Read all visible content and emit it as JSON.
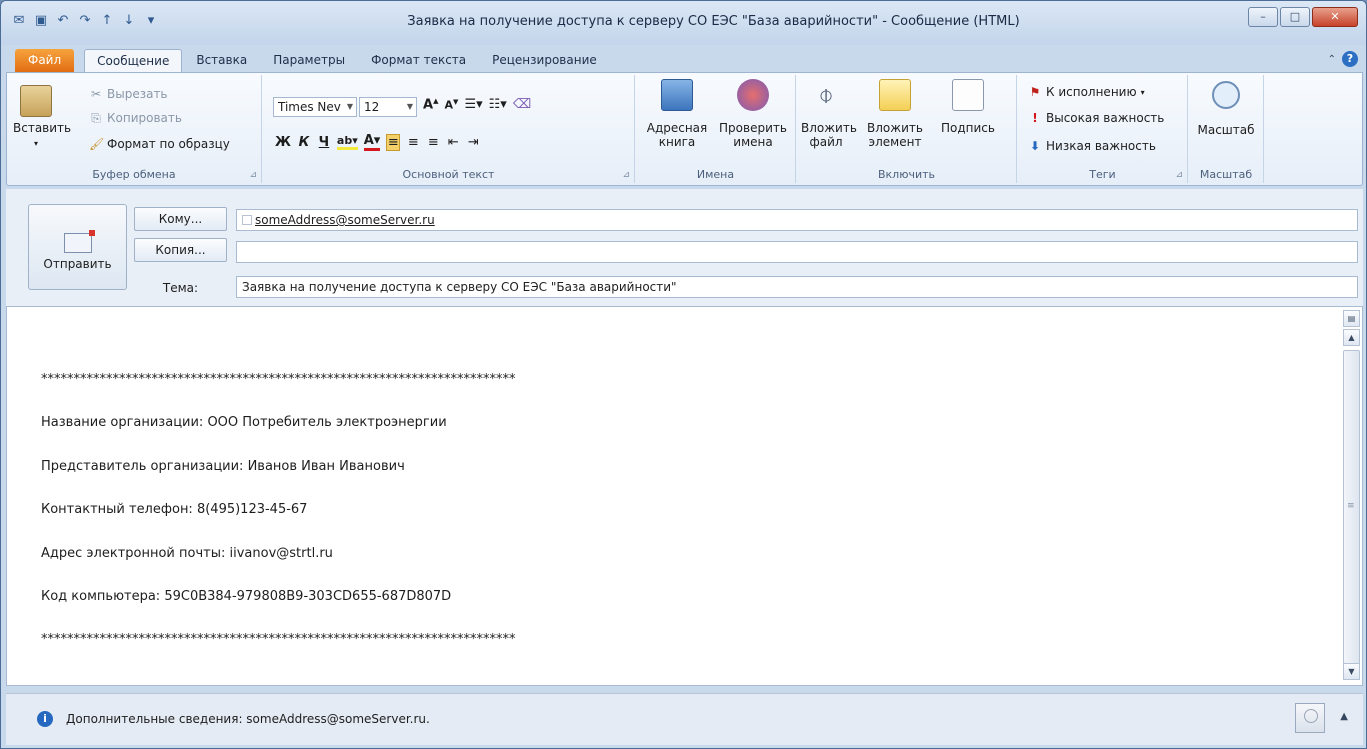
{
  "window": {
    "title": "Заявка на получение доступа к серверу СО ЕЭС \"База аварийности\" - Сообщение (HTML)",
    "buttons": [
      "minimize",
      "maximize",
      "close"
    ]
  },
  "tabs": [
    {
      "label": "Файл"
    },
    {
      "label": "Сообщение"
    },
    {
      "label": "Вставка"
    },
    {
      "label": "Параметры"
    },
    {
      "label": "Формат текста"
    },
    {
      "label": "Рецензирование"
    }
  ],
  "ribbon": {
    "clipboard": {
      "label": "Буфер обмена",
      "paste": "Вставить",
      "cut": "Вырезать",
      "copy": "Копировать",
      "format_painter": "Формат по образцу"
    },
    "text": {
      "label": "Основной текст",
      "font": "Times Nev",
      "size": "12",
      "bold": "Ж",
      "italic": "К",
      "underline": "Ч"
    },
    "names": {
      "label": "Имена",
      "address_book": "Адресная книга",
      "check_names": "Проверить имена"
    },
    "include": {
      "label": "Включить",
      "attach_file": "Вложить файл",
      "attach_item": "Вложить элемент",
      "signature": "Подпись"
    },
    "tags": {
      "label": "Теги",
      "follow_up": "К исполнению",
      "high": "Высокая важность",
      "low": "Низкая важность"
    },
    "zoom": {
      "label": "Масштаб",
      "button": "Масштаб"
    }
  },
  "compose": {
    "send": "Отправить",
    "to_button": "Кому...",
    "cc_button": "Копия...",
    "subject_label": "Тема:",
    "to_value": "someAddress@someServer.ru",
    "cc_value": "",
    "subject_value": "Заявка на получение доступа к серверу СО ЕЭС \"База аварийности\""
  },
  "body": {
    "line1": "*************************************************************************",
    "line2": "Название организации: ООО Потребитель электроэнергии",
    "line3": "Представитель организации: Иванов Иван Иванович",
    "line4": "Контактный телефон: 8(495)123-45-67",
    "line5": "Адрес электронной почты: iivanov@strtl.ru",
    "line6": "Код компьютера: 59C0B384-979808B9-303CD655-687D807D",
    "line7": "*************************************************************************"
  },
  "footer": {
    "text": "Дополнительные сведения: someAddress@someServer.ru."
  },
  "colors": {
    "file_tab": "#e06b10",
    "accent": "#2c6fc3",
    "close": "#c7432a"
  }
}
